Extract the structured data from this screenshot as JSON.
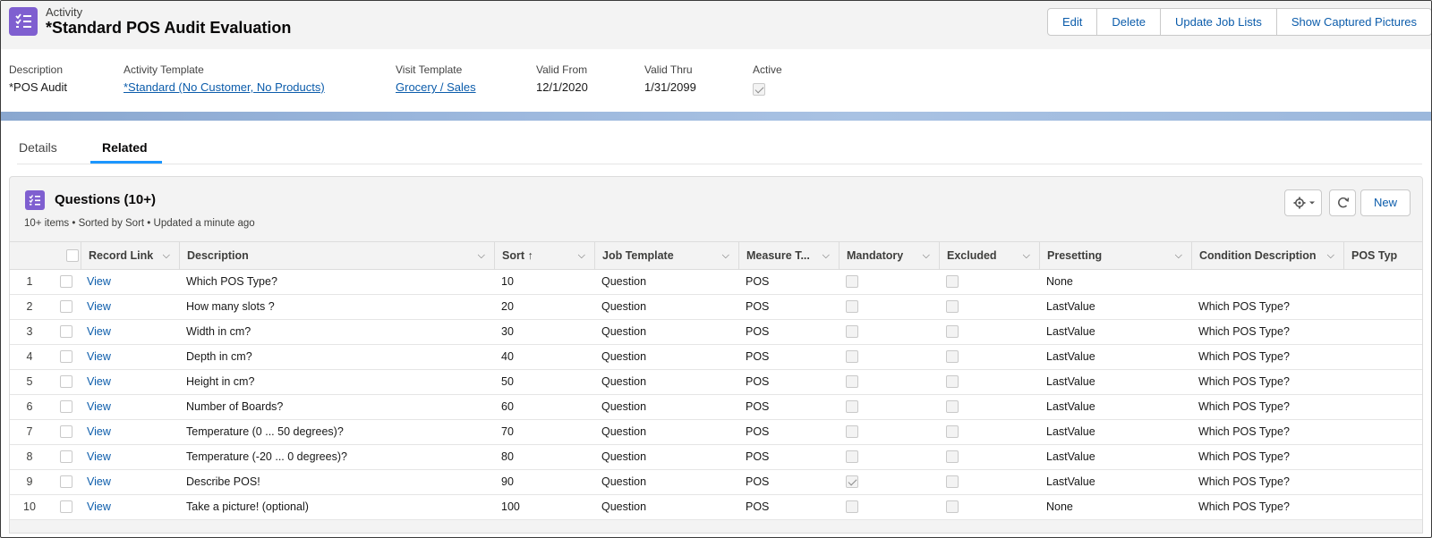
{
  "header": {
    "object_type": "Activity",
    "title": "*Standard POS Audit Evaluation",
    "buttons": [
      "Edit",
      "Delete",
      "Update Job Lists",
      "Show Captured Pictures"
    ]
  },
  "highlights": {
    "description_label": "Description",
    "description_value": "*POS Audit",
    "activity_template_label": "Activity Template",
    "activity_template_value": "*Standard (No Customer, No Products)",
    "visit_template_label": "Visit Template",
    "visit_template_value": "Grocery / Sales",
    "valid_from_label": "Valid From",
    "valid_from_value": "12/1/2020",
    "valid_thru_label": "Valid Thru",
    "valid_thru_value": "1/31/2099",
    "active_label": "Active",
    "active_value": true
  },
  "tabs": [
    {
      "label": "Details",
      "active": false
    },
    {
      "label": "Related",
      "active": true
    }
  ],
  "related_list": {
    "title": "Questions (10+)",
    "subtitle": "10+ items • Sorted by Sort • Updated a minute ago",
    "new_label": "New",
    "columns": [
      "Record Link",
      "Description",
      "Sort ↑",
      "Job Template",
      "Measure T...",
      "Mandatory",
      "Excluded",
      "Presetting",
      "Condition Description",
      "POS Typ"
    ],
    "rows": [
      {
        "n": "1",
        "link": "View",
        "description": "Which POS Type?",
        "sort": "10",
        "job_template": "Question",
        "measure": "POS",
        "mandatory": false,
        "excluded": false,
        "presetting": "None",
        "condition": ""
      },
      {
        "n": "2",
        "link": "View",
        "description": "How many slots ?",
        "sort": "20",
        "job_template": "Question",
        "measure": "POS",
        "mandatory": false,
        "excluded": false,
        "presetting": "LastValue",
        "condition": "Which POS Type?"
      },
      {
        "n": "3",
        "link": "View",
        "description": "Width in cm?",
        "sort": "30",
        "job_template": "Question",
        "measure": "POS",
        "mandatory": false,
        "excluded": false,
        "presetting": "LastValue",
        "condition": "Which POS Type?"
      },
      {
        "n": "4",
        "link": "View",
        "description": "Depth in cm?",
        "sort": "40",
        "job_template": "Question",
        "measure": "POS",
        "mandatory": false,
        "excluded": false,
        "presetting": "LastValue",
        "condition": "Which POS Type?"
      },
      {
        "n": "5",
        "link": "View",
        "description": "Height in cm?",
        "sort": "50",
        "job_template": "Question",
        "measure": "POS",
        "mandatory": false,
        "excluded": false,
        "presetting": "LastValue",
        "condition": "Which POS Type?"
      },
      {
        "n": "6",
        "link": "View",
        "description": "Number of Boards?",
        "sort": "60",
        "job_template": "Question",
        "measure": "POS",
        "mandatory": false,
        "excluded": false,
        "presetting": "LastValue",
        "condition": "Which POS Type?"
      },
      {
        "n": "7",
        "link": "View",
        "description": "Temperature (0 ... 50 degrees)?",
        "sort": "70",
        "job_template": "Question",
        "measure": "POS",
        "mandatory": false,
        "excluded": false,
        "presetting": "LastValue",
        "condition": "Which POS Type?"
      },
      {
        "n": "8",
        "link": "View",
        "description": "Temperature (-20 ... 0 degrees)?",
        "sort": "80",
        "job_template": "Question",
        "measure": "POS",
        "mandatory": false,
        "excluded": false,
        "presetting": "LastValue",
        "condition": "Which POS Type?"
      },
      {
        "n": "9",
        "link": "View",
        "description": "Describe POS!",
        "sort": "90",
        "job_template": "Question",
        "measure": "POS",
        "mandatory": true,
        "excluded": false,
        "presetting": "LastValue",
        "condition": "Which POS Type?"
      },
      {
        "n": "10",
        "link": "View",
        "description": "Take a picture! (optional)",
        "sort": "100",
        "job_template": "Question",
        "measure": "POS",
        "mandatory": false,
        "excluded": false,
        "presetting": "None",
        "condition": "Which POS Type?"
      }
    ]
  },
  "colors": {
    "accent": "#0b5cab",
    "icon": "#7f5fd0",
    "tab_underline": "#1b96ff"
  }
}
